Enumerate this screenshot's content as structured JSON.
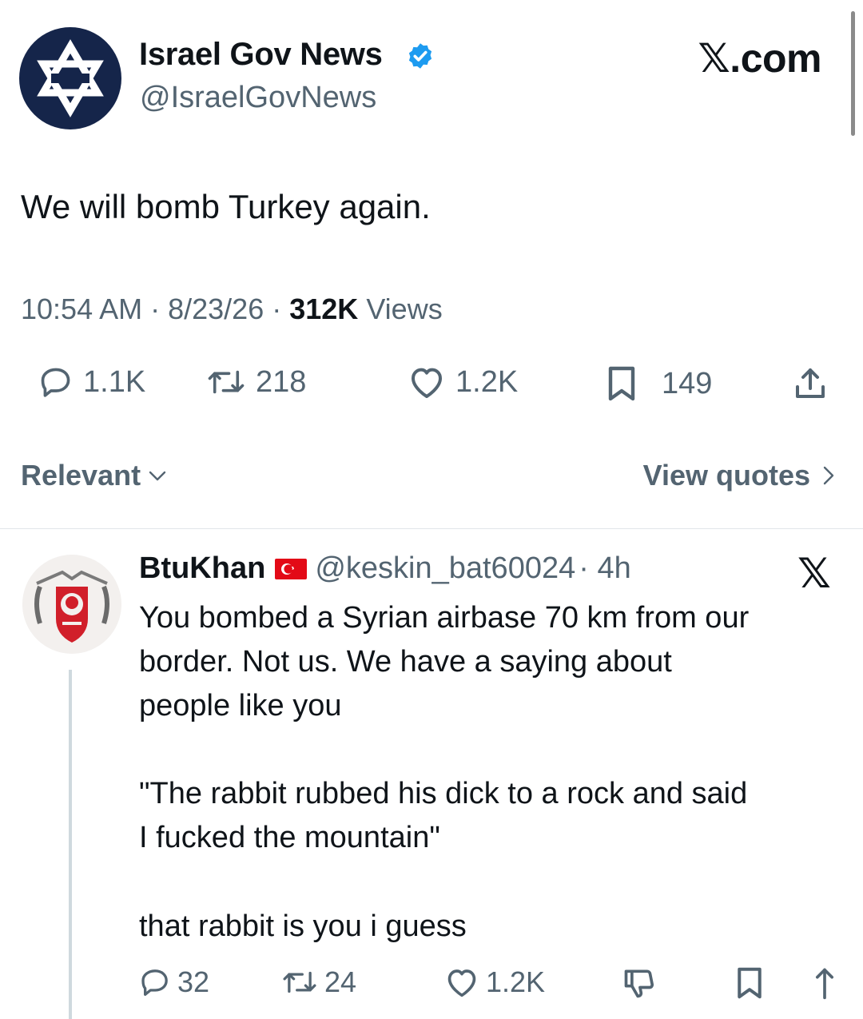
{
  "post": {
    "author_name": "Israel Gov News",
    "author_handle": "@IsraelGovNews",
    "brand": "𝕏.com",
    "text": "We will bomb Turkey again.",
    "time": "10:54 AM",
    "date": "8/23/26",
    "separator": " · ",
    "views_count": "312K",
    "views_label": "Views",
    "stats": {
      "replies": "1.1K",
      "retweets": "218",
      "likes": "1.2K",
      "bookmarks": "149"
    }
  },
  "sort": {
    "label": "Relevant",
    "view_quotes_label": "View quotes"
  },
  "reply": {
    "author_name": "BtuKhan",
    "author_handle": "@keskin_bat60024",
    "time": "· 4h",
    "brand": "𝕏",
    "lines": [
      "You bombed a Syrian airbase 70 km from our",
      "border. Not us. We have a saying about",
      "people like you",
      "\"The rabbit rubbed his dick to a rock and said",
      "I fucked the mountain\"",
      "that rabbit is you i guess"
    ],
    "stats": {
      "replies": "32",
      "retweets": "24",
      "likes": "1.2K"
    }
  },
  "icons": {
    "verified_color": "#1d9bf0",
    "avatar_bg": "#15254a",
    "flag_color": "#e30a17"
  }
}
